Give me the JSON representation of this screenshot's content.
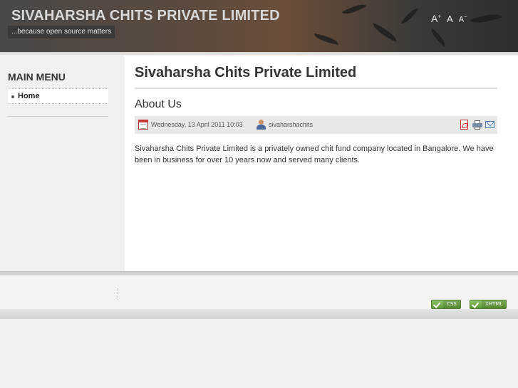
{
  "header": {
    "site_title": "SIVAHARSHA CHITS PRIVATE LIMITED",
    "slogan": "...because open source matters",
    "font_tools": {
      "increase": "A",
      "reset": "A",
      "decrease": "A"
    }
  },
  "sidebar": {
    "menu_title": "MAIN MENU",
    "items": [
      {
        "label": "Home"
      }
    ]
  },
  "main": {
    "page_heading": "Sivaharsha Chits Private Limited",
    "article": {
      "title": "About Us",
      "date": "Wednesday, 13 April 2011 10:03",
      "author": "sivaharshachits",
      "body": "Sivaharsha Chits Private Limited is a privately owned chit fund company located in Bangalore. We have been in business for over 10 years now and served many clients.",
      "icons": [
        "calendar-icon",
        "user-icon",
        "pdf-icon",
        "print-icon",
        "email-icon"
      ]
    }
  },
  "footer": {
    "badges": [
      {
        "label": "CSS"
      },
      {
        "label": "XHTML"
      }
    ]
  },
  "colors": {
    "accent_green": "#5e9a38",
    "header_dark": "#3c3a38"
  }
}
